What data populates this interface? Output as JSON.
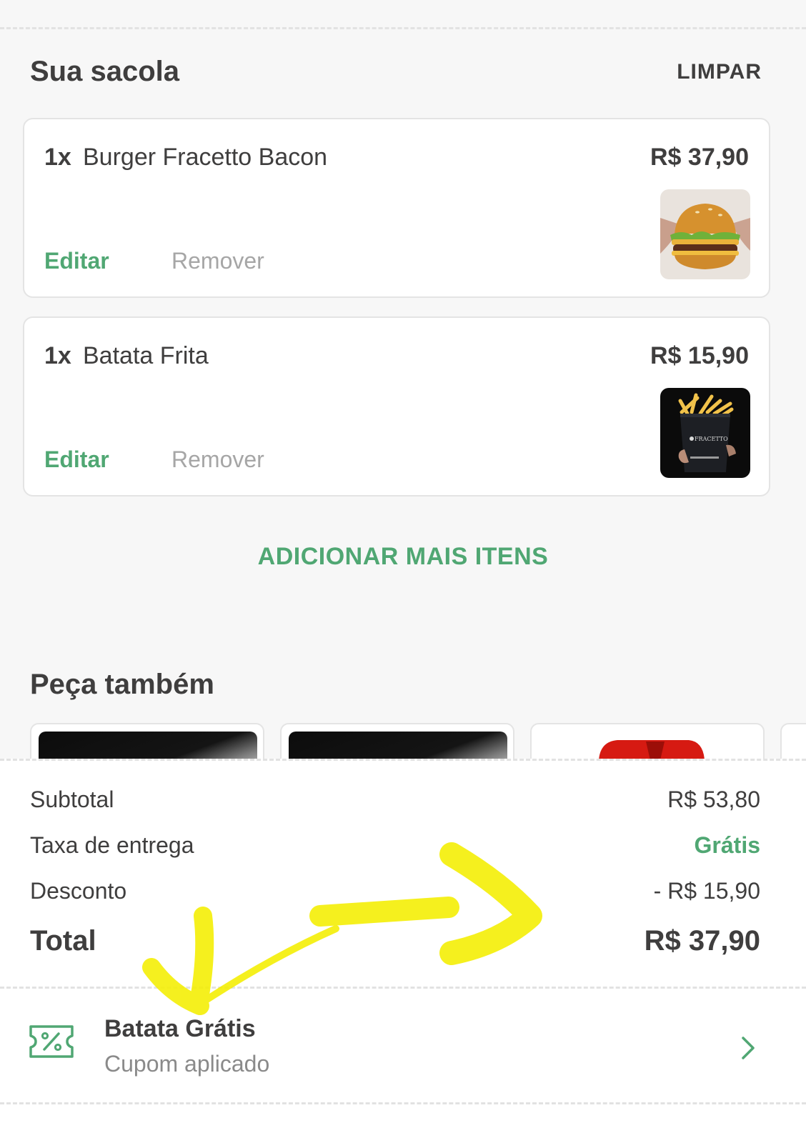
{
  "bag": {
    "title": "Sua sacola",
    "clear_label": "LIMPAR",
    "items": [
      {
        "qty": "1x",
        "name": "Burger Fracetto Bacon",
        "price": "R$ 37,90",
        "edit_label": "Editar",
        "remove_label": "Remover",
        "image_icon": "burger-photo"
      },
      {
        "qty": "1x",
        "name": "Batata Frita",
        "price": "R$ 15,90",
        "edit_label": "Editar",
        "remove_label": "Remover",
        "image_icon": "fries-photo"
      }
    ],
    "add_more_label": "ADICIONAR MAIS ITENS"
  },
  "suggestions": {
    "title": "Peça também"
  },
  "summary": {
    "subtotal_label": "Subtotal",
    "subtotal_value": "R$ 53,80",
    "delivery_label": "Taxa de entrega",
    "delivery_value": "Grátis",
    "discount_label": "Desconto",
    "discount_value": "- R$ 15,90",
    "total_label": "Total",
    "total_value": "R$ 37,90"
  },
  "coupon": {
    "title": "Batata Grátis",
    "subtitle": "Cupom aplicado",
    "icon": "coupon-percent-icon"
  },
  "colors": {
    "accent_green": "#50a773",
    "text_dark": "#3f3e3e",
    "text_muted": "#a6a6a6",
    "annotation_yellow": "#f4ee00"
  }
}
